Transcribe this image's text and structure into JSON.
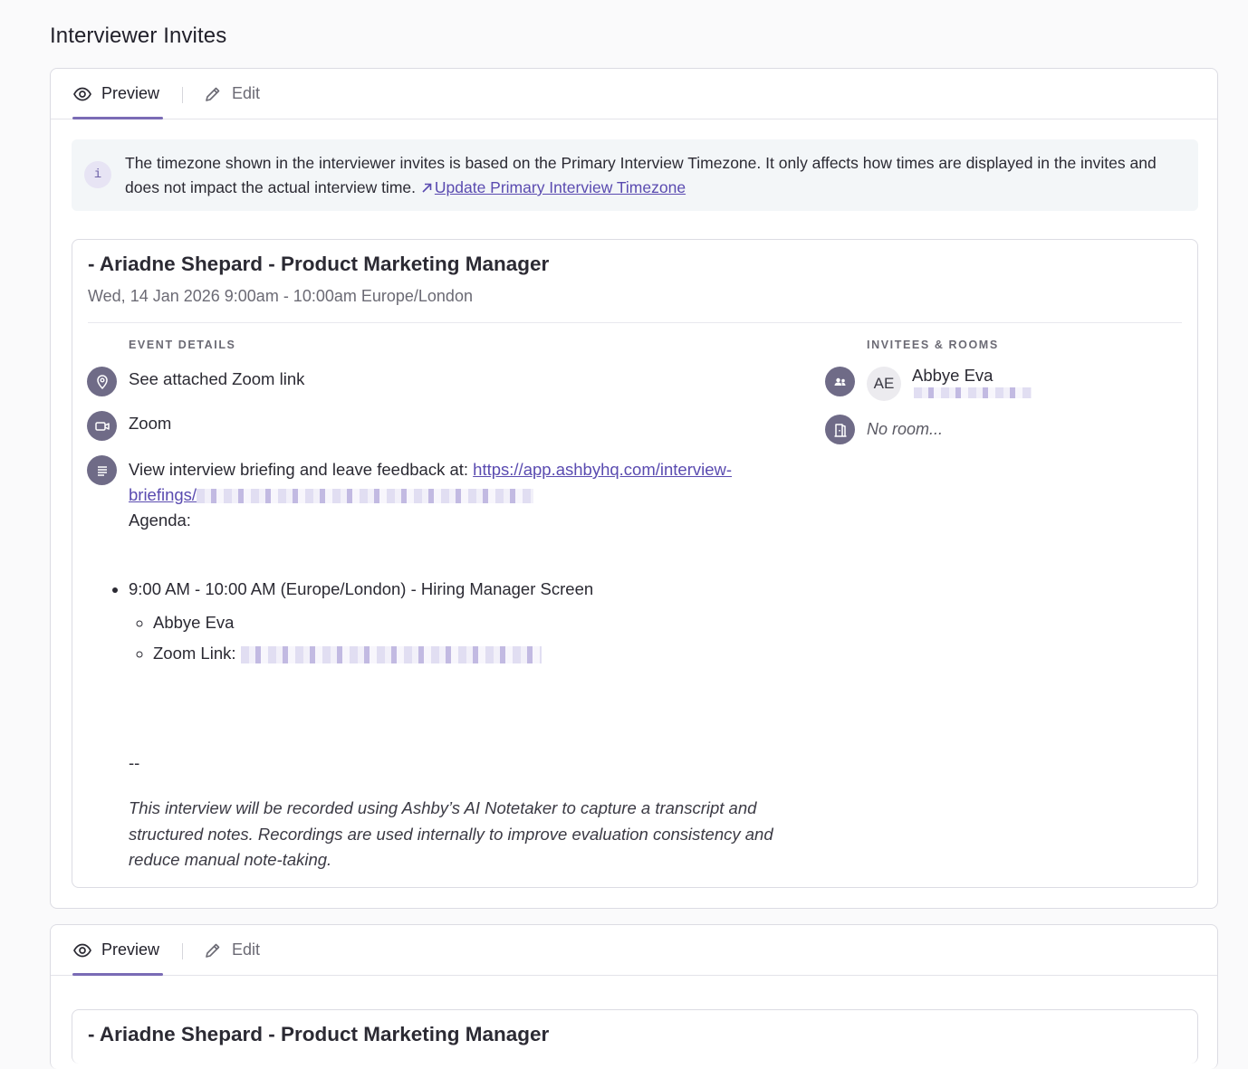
{
  "page": {
    "title": "Interviewer Invites"
  },
  "tabs": {
    "preview_label": "Preview",
    "edit_label": "Edit"
  },
  "info_banner": {
    "icon_char": "i",
    "text": "The timezone shown in the interviewer invites is based on the Primary Interview Timezone. It only affects how times are displayed in the invites and does not impact the actual interview time.",
    "link_label": "Update Primary Interview Timezone"
  },
  "event": {
    "title": "- Ariadne Shepard - Product Marketing Manager",
    "time": "Wed, 14 Jan 2026 9:00am - 10:00am Europe/London",
    "details_label": "EVENT DETAILS",
    "location": "See attached Zoom link",
    "conferencing": "Zoom",
    "description_prefix": "View interview briefing and leave feedback at: ",
    "briefing_link_visible_1": "https://app.ashbyhq.com/interview-",
    "briefing_link_visible_2": "briefings/",
    "agenda_label": "Agenda:",
    "agenda_item": "9:00 AM - 10:00 AM (Europe/London) - Hiring Manager Screen",
    "agenda_sub_1": "Abbye Eva",
    "agenda_sub_2_prefix": "Zoom Link: ",
    "separator": "--",
    "notetaker_note": "This interview will be recorded using Ashby’s AI Notetaker to capture a transcript and structured notes. Recordings are used internally to improve evaluation consistency and reduce manual note-taking.",
    "invitees_label": "INVITEES & ROOMS",
    "invitee_initials": "AE",
    "invitee_name": "Abbye Eva",
    "room": "No room..."
  },
  "colors": {
    "accent": "#7a6bb5",
    "link": "#5a4bb0",
    "icon_circle": "#6f6b87"
  },
  "icons": [
    "eye-icon",
    "pencil-icon",
    "info-icon",
    "location-pin-icon",
    "video-icon",
    "description-icon",
    "people-icon",
    "door-icon",
    "external-link-icon"
  ]
}
